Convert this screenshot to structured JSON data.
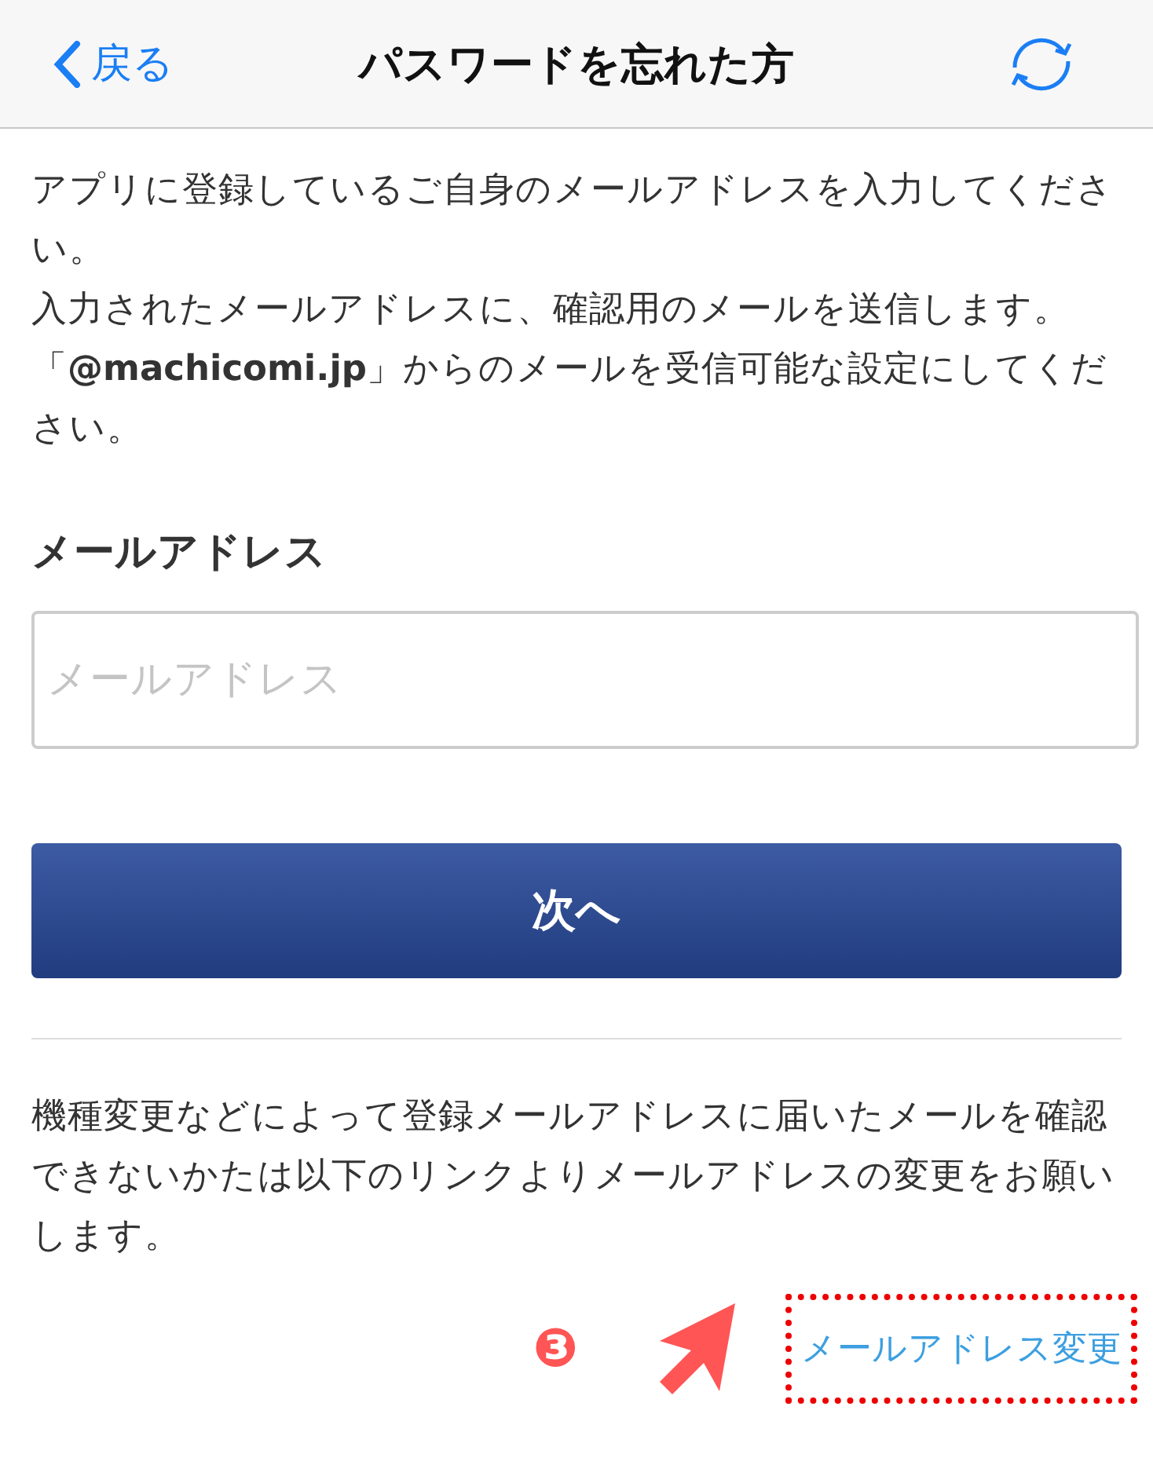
{
  "nav": {
    "back": "戻る",
    "title": "パスワードを忘れた方"
  },
  "intro": [
    "アプリに登録しているご自身のメールアドレスを入力してください。",
    "入力されたメールアドレスに、確認用のメールを送信します。",
    "「**@machicomi.jp**」からのメールを受信可能な設定にしてください。"
  ],
  "email": {
    "label": "メールアドレス",
    "placeholder": "メールアドレス"
  },
  "submit": "次へ",
  "note": "機種変更などによって登録メールアドレスに届いたメールを確認できないかたは以下のリンクよりメールアドレスの変更をお願いします。",
  "link": "メールアドレス変更",
  "annotation": {
    "number": "❸"
  }
}
